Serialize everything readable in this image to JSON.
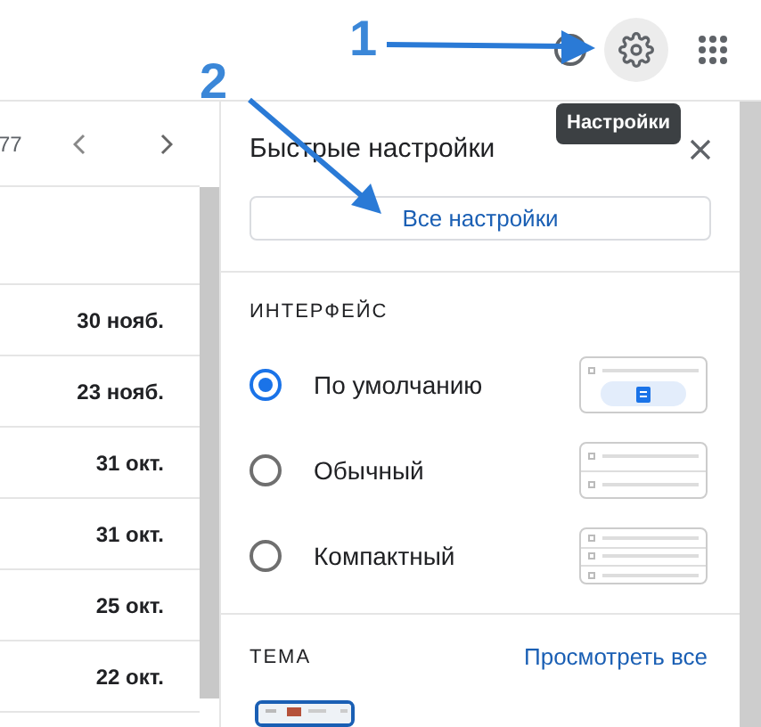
{
  "toolbar": {
    "tooltip": "Настройки"
  },
  "pager": {
    "count": "77"
  },
  "mail_rows": [
    {
      "date": "30 нояб."
    },
    {
      "date": "23 нояб."
    },
    {
      "date": "31 окт."
    },
    {
      "date": "31 окт."
    },
    {
      "date": "25 окт."
    },
    {
      "date": "22 окт."
    }
  ],
  "quick_settings": {
    "title": "Быстрые настройки",
    "all_settings_button": "Все настройки",
    "density": {
      "heading": "ИНТЕРФЕЙС",
      "options": [
        {
          "label": "По умолчанию",
          "selected": true,
          "kind": "default"
        },
        {
          "label": "Обычный",
          "selected": false,
          "kind": "comfortable"
        },
        {
          "label": "Компактный",
          "selected": false,
          "kind": "compact"
        }
      ]
    },
    "theme": {
      "heading": "ТЕМА",
      "view_all_link": "Просмотреть все"
    }
  },
  "annotations": [
    {
      "label": "1"
    },
    {
      "label": "2"
    }
  ]
}
